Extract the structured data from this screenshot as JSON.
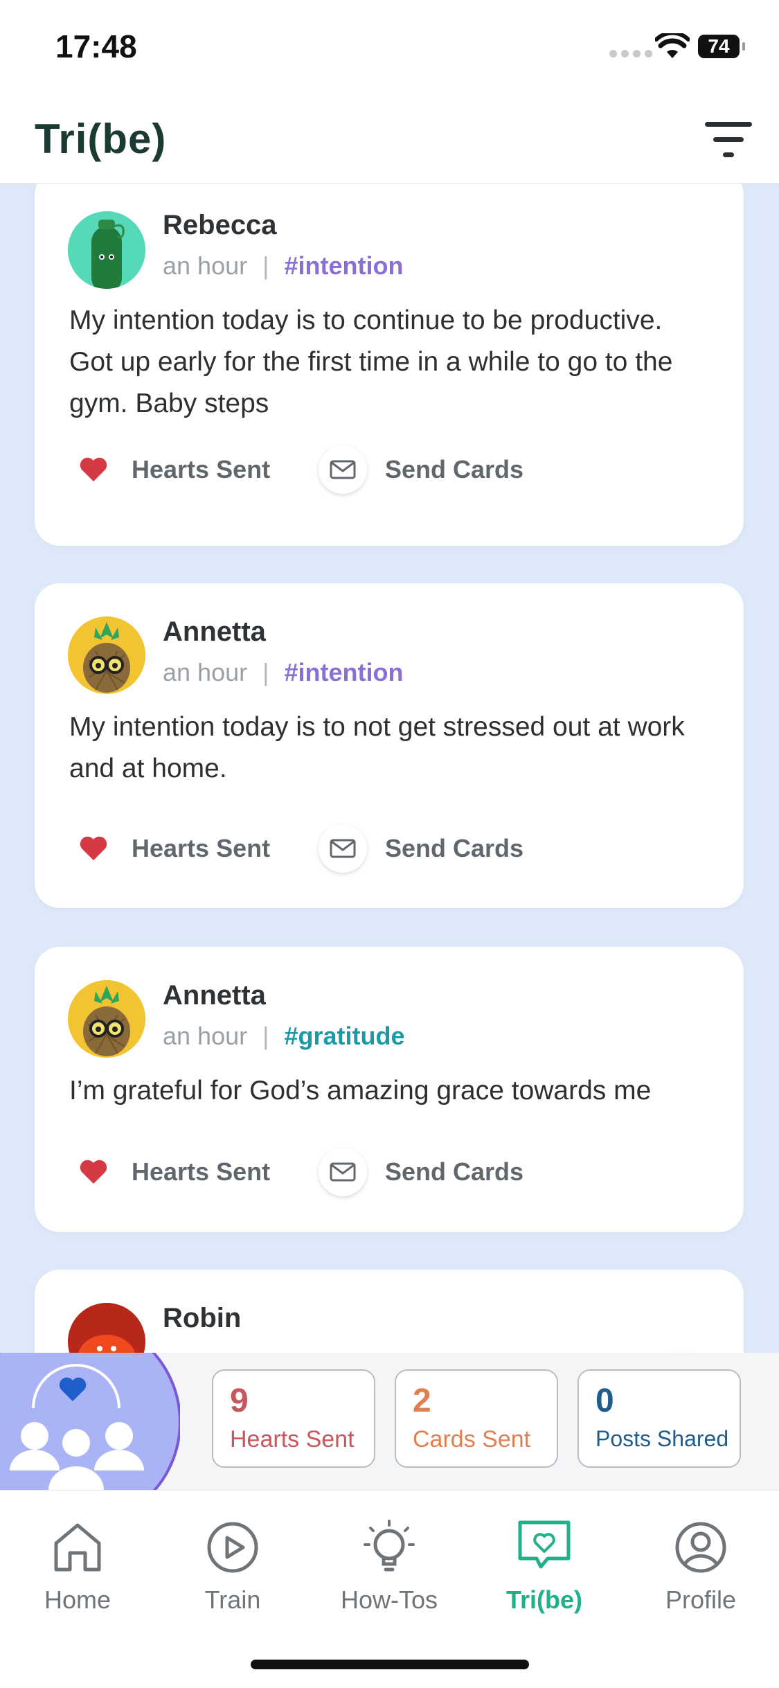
{
  "status_bar": {
    "time": "17:48",
    "battery": "74"
  },
  "header": {
    "title": "Tri(be)"
  },
  "posts": [
    {
      "name": "Rebecca",
      "time": "an hour",
      "tag": "#intention",
      "tag_color": "#8a6fd8",
      "body": "My intention today is to continue to be productive. Got up early for the first time in a while to go to the gym. Baby steps",
      "avatar": "cucumber-avatar",
      "hearts_label": "Hearts Sent",
      "cards_label": "Send Cards"
    },
    {
      "name": "Annetta",
      "time": "an hour",
      "tag": "#intention",
      "tag_color": "#8a6fd8",
      "body": "My intention today is to not get stressed out at work and at home.",
      "avatar": "pineapple-avatar",
      "hearts_label": "Hearts Sent",
      "cards_label": "Send Cards"
    },
    {
      "name": "Annetta",
      "time": "an hour",
      "tag": "#gratitude",
      "tag_color": "#1a9aa6",
      "body": "I’m grateful for God’s amazing grace towards me",
      "avatar": "pineapple-avatar",
      "hearts_label": "Hearts Sent",
      "cards_label": "Send Cards"
    },
    {
      "name": "Robin",
      "avatar": "tomato-avatar"
    }
  ],
  "stats": [
    {
      "value": "9",
      "label": "Hearts Sent",
      "color": "#c8565e"
    },
    {
      "value": "2",
      "label": "Cards Sent",
      "color": "#e08052"
    },
    {
      "value": "0",
      "label": "Posts Shared",
      "color": "#1f5e8c"
    }
  ],
  "tabs": [
    {
      "label": "Home",
      "icon": "home-icon"
    },
    {
      "label": "Train",
      "icon": "play-circle-icon"
    },
    {
      "label": "How-Tos",
      "icon": "lightbulb-icon"
    },
    {
      "label": "Tri(be)",
      "icon": "chat-heart-icon",
      "active": true
    },
    {
      "label": "Profile",
      "icon": "profile-icon"
    }
  ],
  "colors": {
    "accent": "#20b08a",
    "fab": "#1f70d4",
    "heart": "#d43a43"
  }
}
